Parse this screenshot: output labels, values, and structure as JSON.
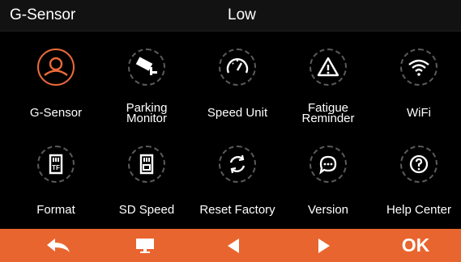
{
  "header": {
    "title": "G-Sensor",
    "value": "Low"
  },
  "menu": [
    {
      "label": "G-Sensor",
      "icon": "driver-icon",
      "selected": true
    },
    {
      "label": "Parking Monitor",
      "icon": "security-camera-icon",
      "selected": false
    },
    {
      "label": "Speed Unit",
      "icon": "speedometer-icon",
      "selected": false
    },
    {
      "label": "Fatigue Reminder",
      "icon": "warning-triangle-icon",
      "selected": false
    },
    {
      "label": "WiFi",
      "icon": "wifi-icon",
      "selected": false
    },
    {
      "label": "Format",
      "icon": "tf-card-icon",
      "selected": false
    },
    {
      "label": "SD Speed",
      "icon": "sd-card-icon",
      "selected": false
    },
    {
      "label": "Reset Factory",
      "icon": "reset-icon",
      "selected": false
    },
    {
      "label": "Version",
      "icon": "chat-bubble-icon",
      "selected": false
    },
    {
      "label": "Help Center",
      "icon": "question-icon",
      "selected": false
    }
  ],
  "footer": {
    "back_icon": "back-arrow-icon",
    "menu_icon": "monitor-icon",
    "left_icon": "triangle-left-icon",
    "right_icon": "triangle-right-icon",
    "ok_label": "OK"
  },
  "colors": {
    "accent": "#e9652f",
    "header_bg": "#121212",
    "ring": "#5a5a5a"
  }
}
